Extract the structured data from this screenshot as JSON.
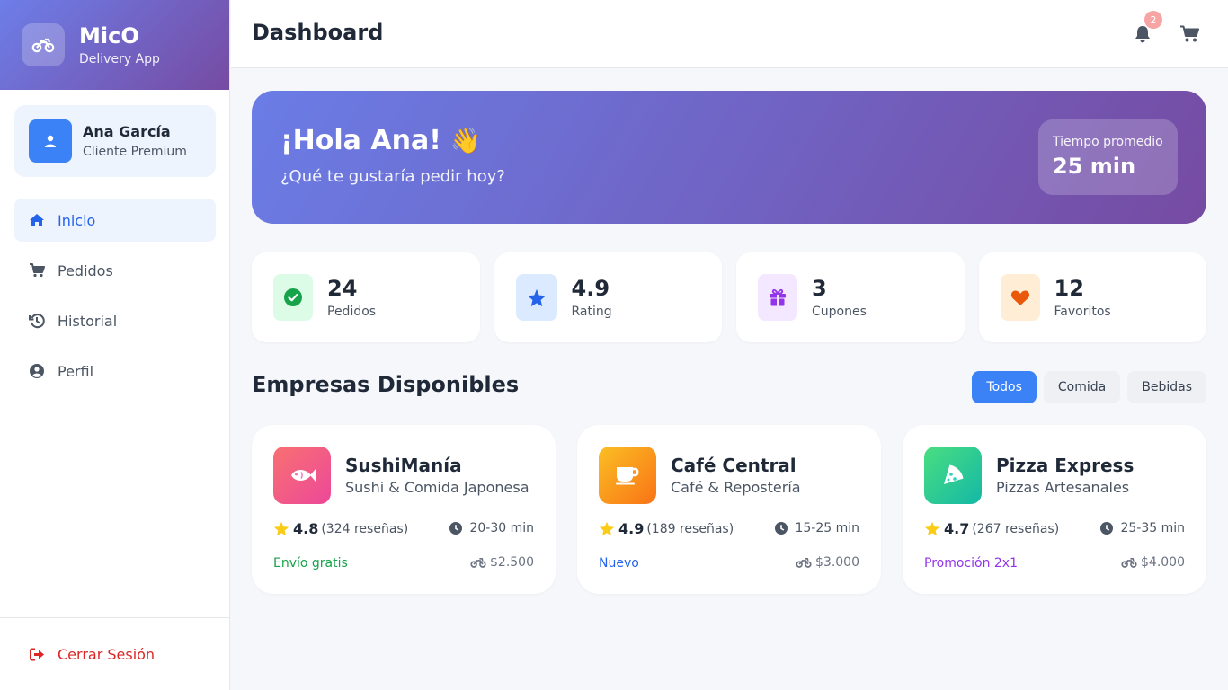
{
  "brand": {
    "name": "MicO",
    "subtitle": "Delivery App",
    "icon": "motorcycle-icon"
  },
  "user": {
    "name": "Ana García",
    "role": "Cliente Premium",
    "icon": "user-icon"
  },
  "nav": [
    {
      "label": "Inicio",
      "icon": "home-icon",
      "active": true
    },
    {
      "label": "Pedidos",
      "icon": "cart-icon",
      "active": false
    },
    {
      "label": "Historial",
      "icon": "history-icon",
      "active": false
    },
    {
      "label": "Perfil",
      "icon": "user-circle-icon",
      "active": false
    }
  ],
  "logout": {
    "label": "Cerrar Sesión",
    "icon": "sign-out-icon"
  },
  "header": {
    "title": "Dashboard",
    "notifications": "2"
  },
  "hero": {
    "greeting": "¡Hola Ana!",
    "emoji": "👋",
    "subtitle": "¿Qué te gustaría pedir hoy?",
    "stat_label": "Tiempo promedio",
    "stat_value": "25 min"
  },
  "stats": [
    {
      "value": "24",
      "label": "Pedidos",
      "icon": "check-circle-icon",
      "bg": "#dcfce7",
      "color": "#16a34a"
    },
    {
      "value": "4.9",
      "label": "Rating",
      "icon": "star-icon",
      "bg": "#dbeafe",
      "color": "#2563eb"
    },
    {
      "value": "3",
      "label": "Cupones",
      "icon": "gift-icon",
      "bg": "#f3e8ff",
      "color": "#9333ea"
    },
    {
      "value": "12",
      "label": "Favoritos",
      "icon": "heart-icon",
      "bg": "#ffedd5",
      "color": "#ea580c"
    }
  ],
  "section": {
    "title": "Empresas Disponibles",
    "filters": [
      {
        "label": "Todos",
        "active": true
      },
      {
        "label": "Comida",
        "active": false
      },
      {
        "label": "Bebidas",
        "active": false
      }
    ]
  },
  "companies": [
    {
      "name": "SushiManía",
      "category": "Sushi & Comida Japonesa",
      "icon": "fish-icon",
      "gradient": [
        "#f87171",
        "#ec4899"
      ],
      "rating": "4.8",
      "reviews": "(324 reseñas)",
      "time": "20-30 min",
      "tag": "Envío gratis",
      "tag_color": "#16a34a",
      "fee": "$2.500"
    },
    {
      "name": "Café Central",
      "category": "Café & Repostería",
      "icon": "coffee-icon",
      "gradient": [
        "#fbbf24",
        "#f97316"
      ],
      "rating": "4.9",
      "reviews": "(189 reseñas)",
      "time": "15-25 min",
      "tag": "Nuevo",
      "tag_color": "#2563eb",
      "fee": "$3.000"
    },
    {
      "name": "Pizza Express",
      "category": "Pizzas Artesanales",
      "icon": "pizza-icon",
      "gradient": [
        "#4ade80",
        "#14b8a6"
      ],
      "rating": "4.7",
      "reviews": "(267 reseñas)",
      "time": "25-35 min",
      "tag": "Promoción 2x1",
      "tag_color": "#9333ea",
      "fee": "$4.000"
    }
  ]
}
